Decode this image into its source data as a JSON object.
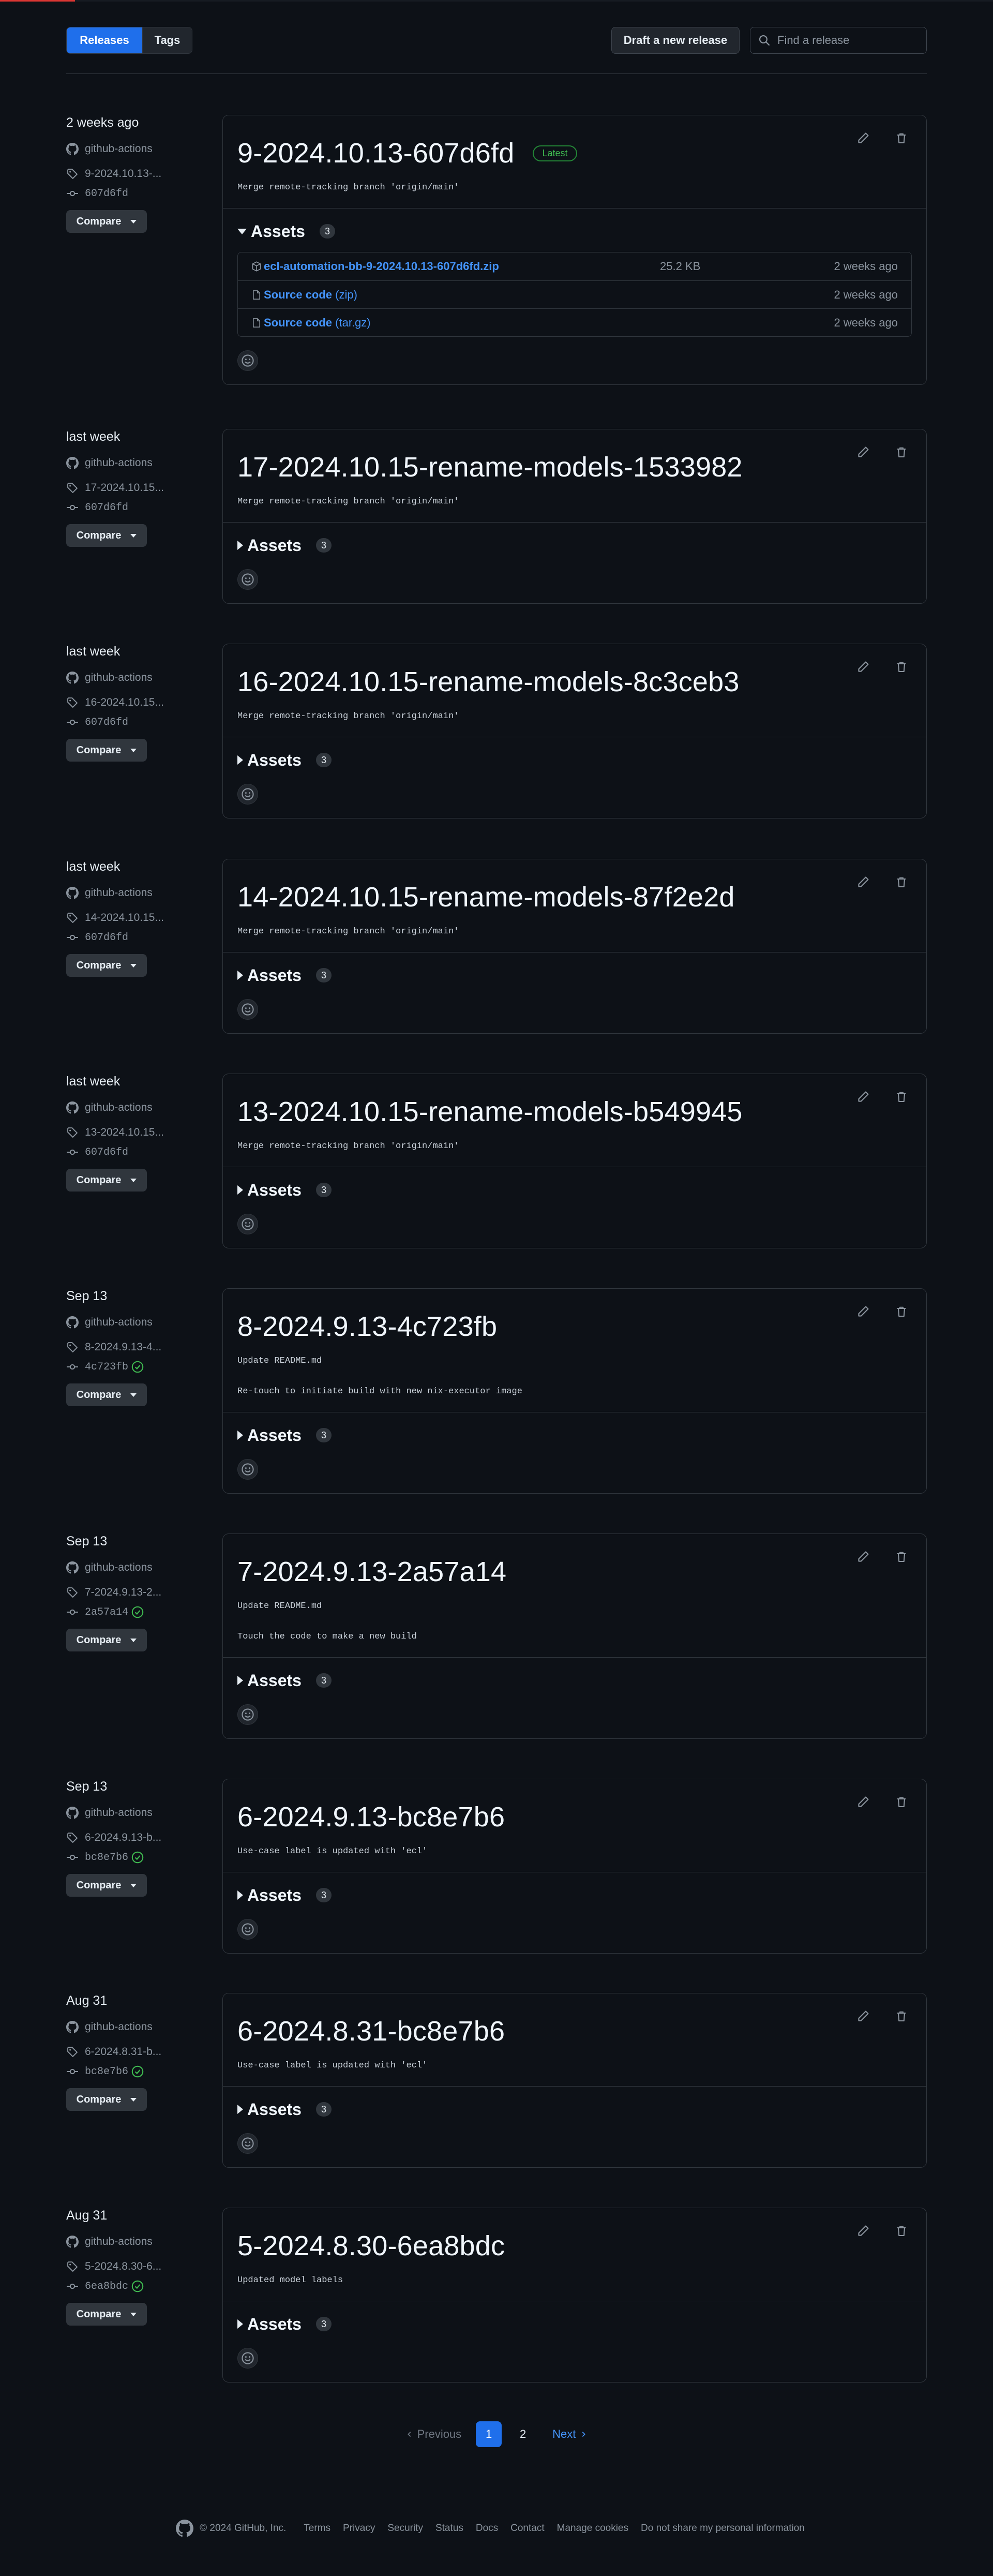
{
  "header": {
    "tab_releases": "Releases",
    "tab_tags": "Tags",
    "draft_label": "Draft a new release",
    "search_placeholder": "Find a release"
  },
  "compare_label": "Compare",
  "assets_label": "Assets",
  "releases": [
    {
      "date": "2 weeks ago",
      "author": "github-actions",
      "tag": "9-2024.10.13-...",
      "commit": "607d6fd",
      "verified": false,
      "title": "9-2024.10.13-607d6fd",
      "latest": "Latest",
      "body": [
        "Merge remote-tracking branch 'origin/main'"
      ],
      "asset_count": "3",
      "expanded": true,
      "assets": [
        {
          "name": "ecl-automation-bb-9-2024.10.13-607d6fd.zip",
          "ext": "",
          "size": "25.2 KB",
          "when": "2 weeks ago"
        },
        {
          "name": "Source code",
          "ext": " (zip)",
          "size": "",
          "when": "2 weeks ago"
        },
        {
          "name": "Source code",
          "ext": " (tar.gz)",
          "size": "",
          "when": "2 weeks ago"
        }
      ]
    },
    {
      "date": "last week",
      "author": "github-actions",
      "tag": "17-2024.10.15...",
      "commit": "607d6fd",
      "verified": false,
      "title": "17-2024.10.15-rename-models-1533982",
      "body": [
        "Merge remote-tracking branch 'origin/main'"
      ],
      "asset_count": "3"
    },
    {
      "date": "last week",
      "author": "github-actions",
      "tag": "16-2024.10.15...",
      "commit": "607d6fd",
      "verified": false,
      "title": "16-2024.10.15-rename-models-8c3ceb3",
      "body": [
        "Merge remote-tracking branch 'origin/main'"
      ],
      "asset_count": "3"
    },
    {
      "date": "last week",
      "author": "github-actions",
      "tag": "14-2024.10.15...",
      "commit": "607d6fd",
      "verified": false,
      "title": "14-2024.10.15-rename-models-87f2e2d",
      "body": [
        "Merge remote-tracking branch 'origin/main'"
      ],
      "asset_count": "3"
    },
    {
      "date": "last week",
      "author": "github-actions",
      "tag": "13-2024.10.15...",
      "commit": "607d6fd",
      "verified": false,
      "title": "13-2024.10.15-rename-models-b549945",
      "body": [
        "Merge remote-tracking branch 'origin/main'"
      ],
      "asset_count": "3"
    },
    {
      "date": "Sep 13",
      "author": "github-actions",
      "tag": "8-2024.9.13-4...",
      "commit": "4c723fb",
      "verified": true,
      "title": "8-2024.9.13-4c723fb",
      "body": [
        "Update README.md",
        "Re-touch to initiate build with new nix-executor image"
      ],
      "asset_count": "3"
    },
    {
      "date": "Sep 13",
      "author": "github-actions",
      "tag": "7-2024.9.13-2...",
      "commit": "2a57a14",
      "verified": true,
      "title": "7-2024.9.13-2a57a14",
      "body": [
        "Update README.md",
        "Touch the code to make a new build"
      ],
      "asset_count": "3"
    },
    {
      "date": "Sep 13",
      "author": "github-actions",
      "tag": "6-2024.9.13-b...",
      "commit": "bc8e7b6",
      "verified": true,
      "title": "6-2024.9.13-bc8e7b6",
      "body": [
        "Use-case label is updated with 'ecl'"
      ],
      "asset_count": "3"
    },
    {
      "date": "Aug 31",
      "author": "github-actions",
      "tag": "6-2024.8.31-b...",
      "commit": "bc8e7b6",
      "verified": true,
      "title": "6-2024.8.31-bc8e7b6",
      "body": [
        "Use-case label is updated with 'ecl'"
      ],
      "asset_count": "3"
    },
    {
      "date": "Aug 31",
      "author": "github-actions",
      "tag": "5-2024.8.30-6...",
      "commit": "6ea8bdc",
      "verified": true,
      "title": "5-2024.8.30-6ea8bdc",
      "body": [
        "Updated model labels"
      ],
      "asset_count": "3"
    }
  ],
  "pagination": {
    "previous": "Previous",
    "pages": [
      "1",
      "2"
    ],
    "current": "1",
    "next": "Next"
  },
  "footer": {
    "copyright": "© 2024 GitHub, Inc.",
    "links": [
      "Terms",
      "Privacy",
      "Security",
      "Status",
      "Docs",
      "Contact",
      "Manage cookies",
      "Do not share my personal information"
    ]
  }
}
